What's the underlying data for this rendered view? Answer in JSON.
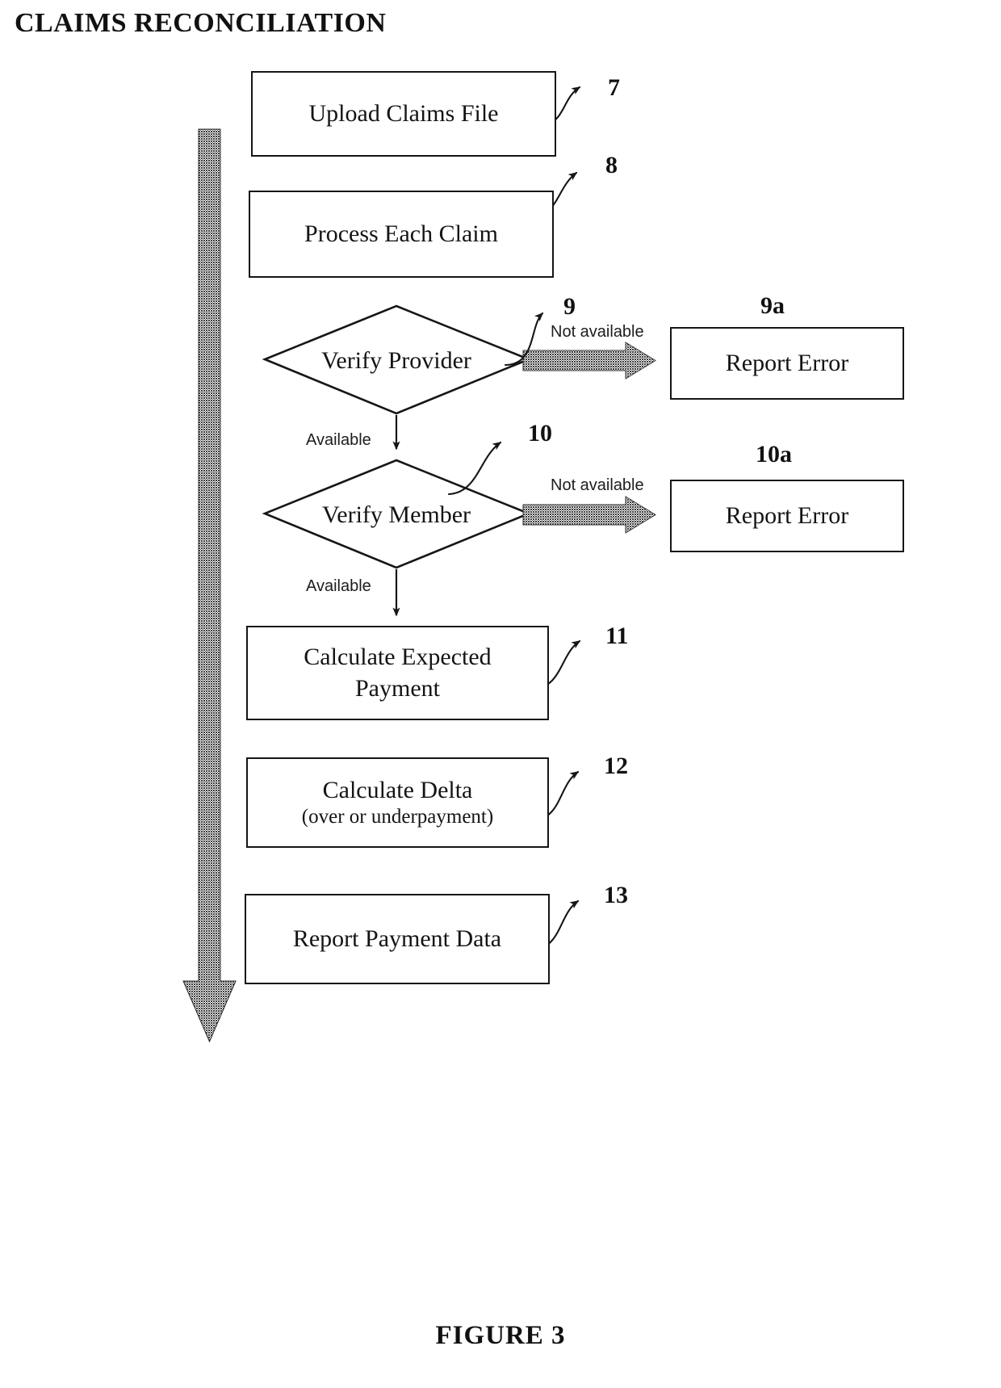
{
  "figure": {
    "title": "CLAIMS RECONCILIATION",
    "caption": "FIGURE 3"
  },
  "colors": {
    "stroke": "#161616",
    "thick_arrow_fill": "#6b6b6b",
    "background": "#ffffff"
  },
  "flow": {
    "steps": [
      {
        "id": "upload",
        "shape": "process",
        "label": "Upload Claims File",
        "ref": "7"
      },
      {
        "id": "process",
        "shape": "process",
        "label": "Process Each Claim",
        "ref": "8"
      },
      {
        "id": "provider",
        "shape": "decision",
        "label": "Verify Provider",
        "ref": "9"
      },
      {
        "id": "member",
        "shape": "decision",
        "label": "Verify Member",
        "ref": "10"
      },
      {
        "id": "expected",
        "shape": "process",
        "label_line1": "Calculate Expected",
        "label_line2": "Payment",
        "ref": "11"
      },
      {
        "id": "delta",
        "shape": "process",
        "label": "Calculate Delta",
        "sublabel": "(over or underpayment)",
        "ref": "12"
      },
      {
        "id": "report",
        "shape": "process",
        "label": "Report Payment Data",
        "ref": "13"
      }
    ],
    "error_branches": [
      {
        "id": "provider-error",
        "label": "Report Error",
        "ref": "9a",
        "edge_label": "Not available"
      },
      {
        "id": "member-error",
        "label": "Report Error",
        "ref": "10a",
        "edge_label": "Not available"
      }
    ],
    "pass_labels": [
      {
        "id": "provider-pass",
        "label": "Available"
      },
      {
        "id": "member-pass",
        "label": "Available"
      }
    ]
  }
}
